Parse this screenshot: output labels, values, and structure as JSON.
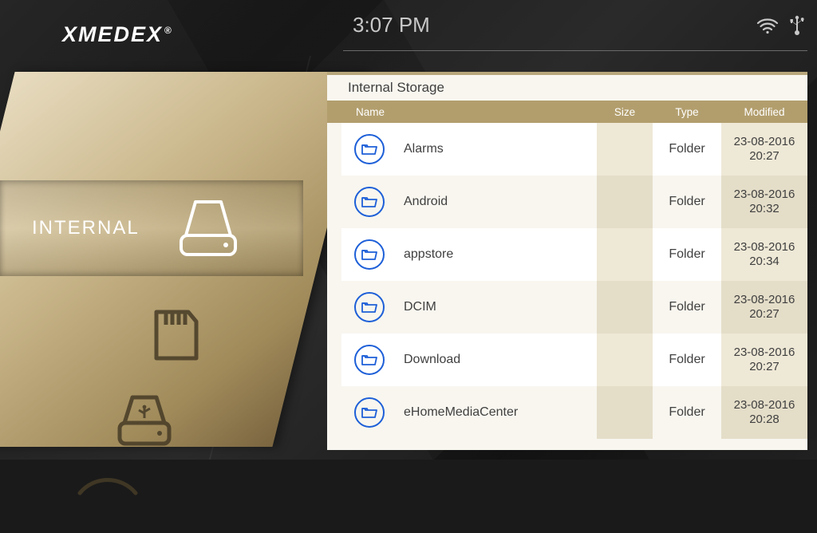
{
  "brand": "XMEDEX",
  "clock": "3:07 PM",
  "sidebar": {
    "selected_label": "INTERNAL"
  },
  "panel": {
    "title": "Internal Storage",
    "columns": {
      "name": "Name",
      "size": "Size",
      "type": "Type",
      "modified": "Modified"
    },
    "rows": [
      {
        "name": "Alarms",
        "size": "",
        "type": "Folder",
        "modified": "23-08-2016\n20:27"
      },
      {
        "name": "Android",
        "size": "",
        "type": "Folder",
        "modified": "23-08-2016\n20:32"
      },
      {
        "name": "appstore",
        "size": "",
        "type": "Folder",
        "modified": "23-08-2016\n20:34"
      },
      {
        "name": "DCIM",
        "size": "",
        "type": "Folder",
        "modified": "23-08-2016\n20:27"
      },
      {
        "name": "Download",
        "size": "",
        "type": "Folder",
        "modified": "23-08-2016\n20:27"
      },
      {
        "name": "eHomeMediaCenter",
        "size": "",
        "type": "Folder",
        "modified": "23-08-2016\n20:28"
      }
    ]
  }
}
